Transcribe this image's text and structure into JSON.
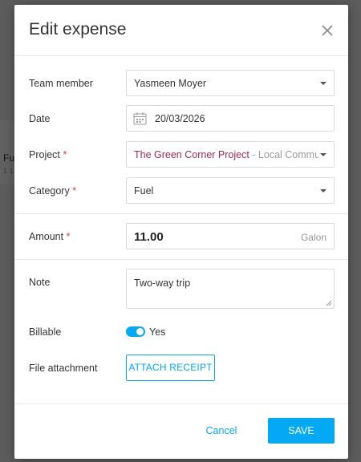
{
  "background": {
    "text1": "Fu",
    "text2": "1 1"
  },
  "modal": {
    "title": "Edit expense"
  },
  "form": {
    "team_member": {
      "label": "Team member",
      "value": "Yasmeen Moyer"
    },
    "date": {
      "label": "Date",
      "value": "20/03/2026"
    },
    "project": {
      "label": "Project",
      "required_mark": "*",
      "value_main": "The Green Corner Project",
      "separator": " - ",
      "value_sub": "Local Community"
    },
    "category": {
      "label": "Category",
      "required_mark": "*",
      "value": "Fuel"
    },
    "amount": {
      "label": "Amount",
      "required_mark": "*",
      "value": "11.00",
      "unit": "Galon"
    },
    "note": {
      "label": "Note",
      "value": "Two-way trip"
    },
    "billable": {
      "label": "Billable",
      "state": true,
      "state_label": "Yes"
    },
    "attachment": {
      "label": "File attachment",
      "button": "ATTACH RECEIPT"
    }
  },
  "footer": {
    "cancel": "Cancel",
    "save": "SAVE"
  },
  "colors": {
    "accent": "#03a9f4",
    "required": "#e03c3c",
    "project_name": "#9b2c4e"
  }
}
